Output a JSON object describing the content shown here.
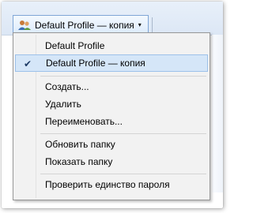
{
  "toolbar": {
    "profile_button_label": "Default Profile — копия"
  },
  "menu": {
    "items": [
      {
        "label": "Default Profile",
        "checked": false
      },
      {
        "label": "Default Profile — копия",
        "checked": true
      },
      {
        "label": "Создать..."
      },
      {
        "label": "Удалить"
      },
      {
        "label": "Переименовать..."
      },
      {
        "label": "Обновить папку"
      },
      {
        "label": "Показать папку"
      },
      {
        "label": "Проверить единство пароля"
      }
    ]
  },
  "icons": {
    "profile": "users-icon",
    "check": "checkmark-icon",
    "chevron": "chevron-down-icon"
  }
}
